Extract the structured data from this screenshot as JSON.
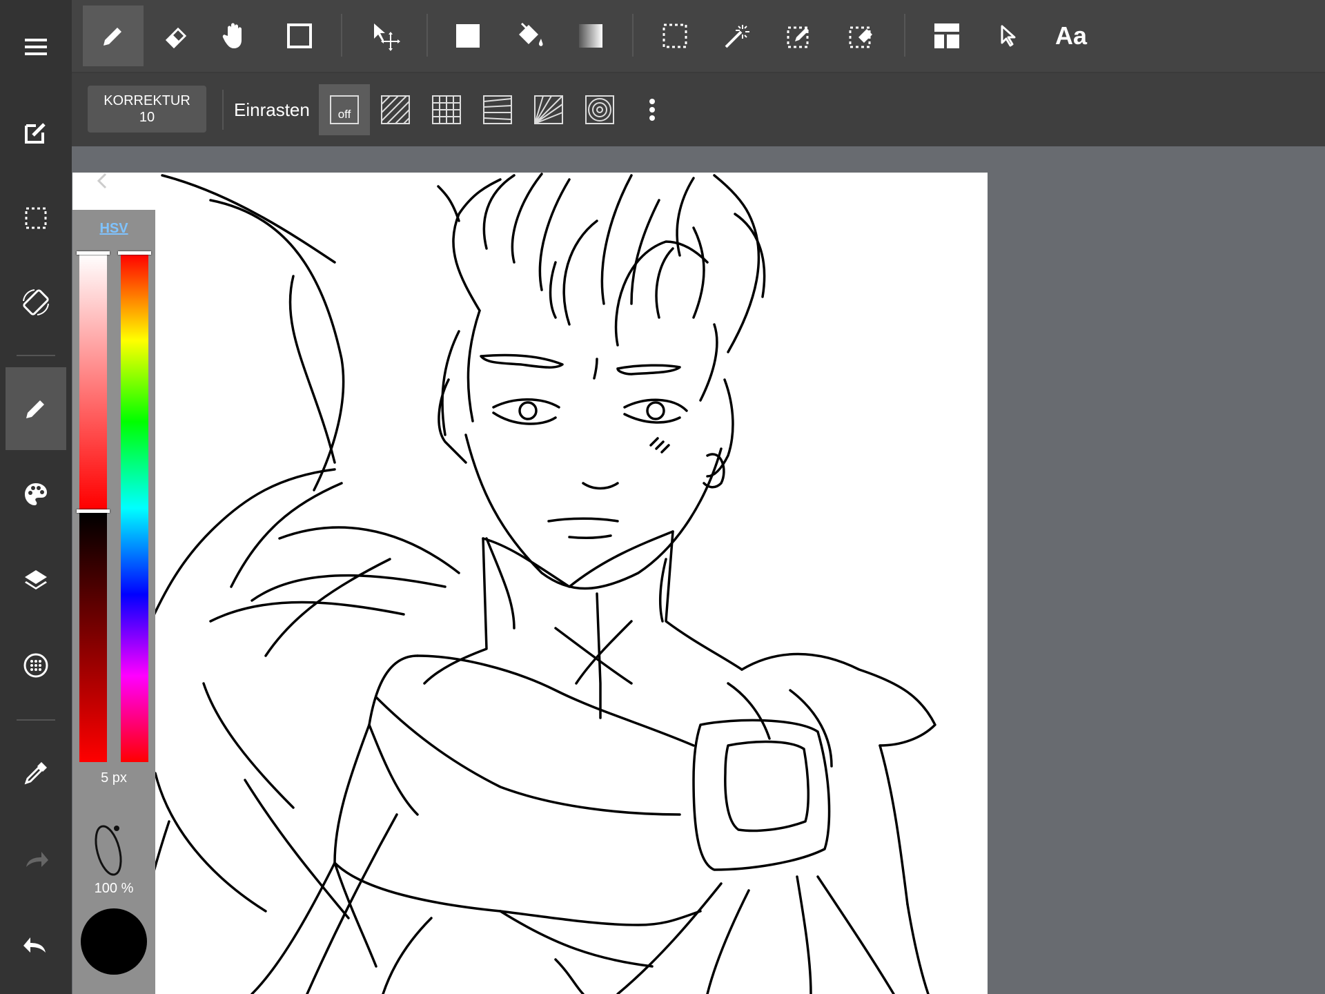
{
  "toolbar": {
    "text_tool_label": "Aa"
  },
  "subtoolbar": {
    "correction_label": "KORREKTUR",
    "correction_value": "10",
    "snap_label": "Einrasten",
    "snap_off_label": "off"
  },
  "color_panel": {
    "mode_label": "HSV",
    "brush_size": "5 px",
    "opacity": "100 %",
    "current_color": "#000000"
  },
  "icons": {
    "left": [
      "menu-icon",
      "edit-icon",
      "selection-icon",
      "rotate-screen-icon",
      "pen-icon",
      "palette-icon",
      "layers-icon",
      "grid-dots-icon",
      "eyedropper-icon",
      "redo-icon",
      "undo-icon"
    ],
    "top": [
      "pen-icon",
      "eraser-icon",
      "hand-icon",
      "shape-square-icon",
      "move-icon",
      "fill-rectangle-icon",
      "bucket-icon",
      "gradient-icon",
      "select-rectangle-icon",
      "magic-wand-icon",
      "select-pen-icon",
      "select-eraser-icon",
      "frame-divider-icon",
      "pointer-icon"
    ]
  },
  "colors": {
    "accent": "#7fc3ff"
  }
}
